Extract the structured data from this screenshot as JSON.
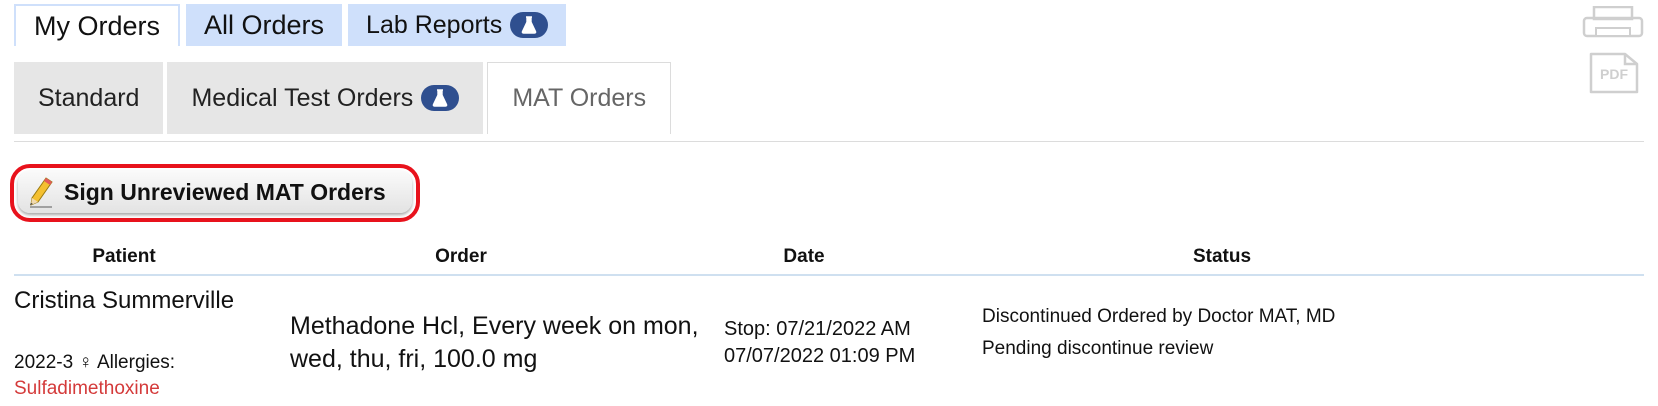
{
  "top_tabs": [
    {
      "label": "My Orders",
      "active": true
    },
    {
      "label": "All Orders",
      "active": false
    },
    {
      "label": "Lab Reports",
      "active": false,
      "icon": "flask-icon"
    }
  ],
  "sub_tabs": [
    {
      "label": "Standard",
      "active": false
    },
    {
      "label": "Medical Test Orders",
      "active": false,
      "icon": "flask-icon"
    },
    {
      "label": "MAT Orders",
      "active": true
    }
  ],
  "toolbar": {
    "sign_label": "Sign Unreviewed MAT Orders",
    "pdf_label": "PDF"
  },
  "table": {
    "headers": {
      "patient": "Patient",
      "order": "Order",
      "date": "Date",
      "status": "Status"
    },
    "rows": [
      {
        "patient_name": "Cristina Summerville",
        "patient_id": "2022-3",
        "gender_symbol": "♀",
        "allergies_label": "Allergies:",
        "allergy": "Sulfadimethoxine",
        "order": "Methadone Hcl, Every week on mon, wed, thu, fri, 100.0 mg",
        "date": "Stop: 07/21/2022 AM 07/07/2022 01:09 PM",
        "status_line1": "Discontinued Ordered by Doctor MAT, MD",
        "status_line2": "Pending discontinue review"
      }
    ]
  },
  "colors": {
    "tab_blue": "#cfe0fb",
    "badge_blue": "#2f4f8f",
    "highlight_red": "#e8121c",
    "allergy_red": "#d43a3a"
  }
}
